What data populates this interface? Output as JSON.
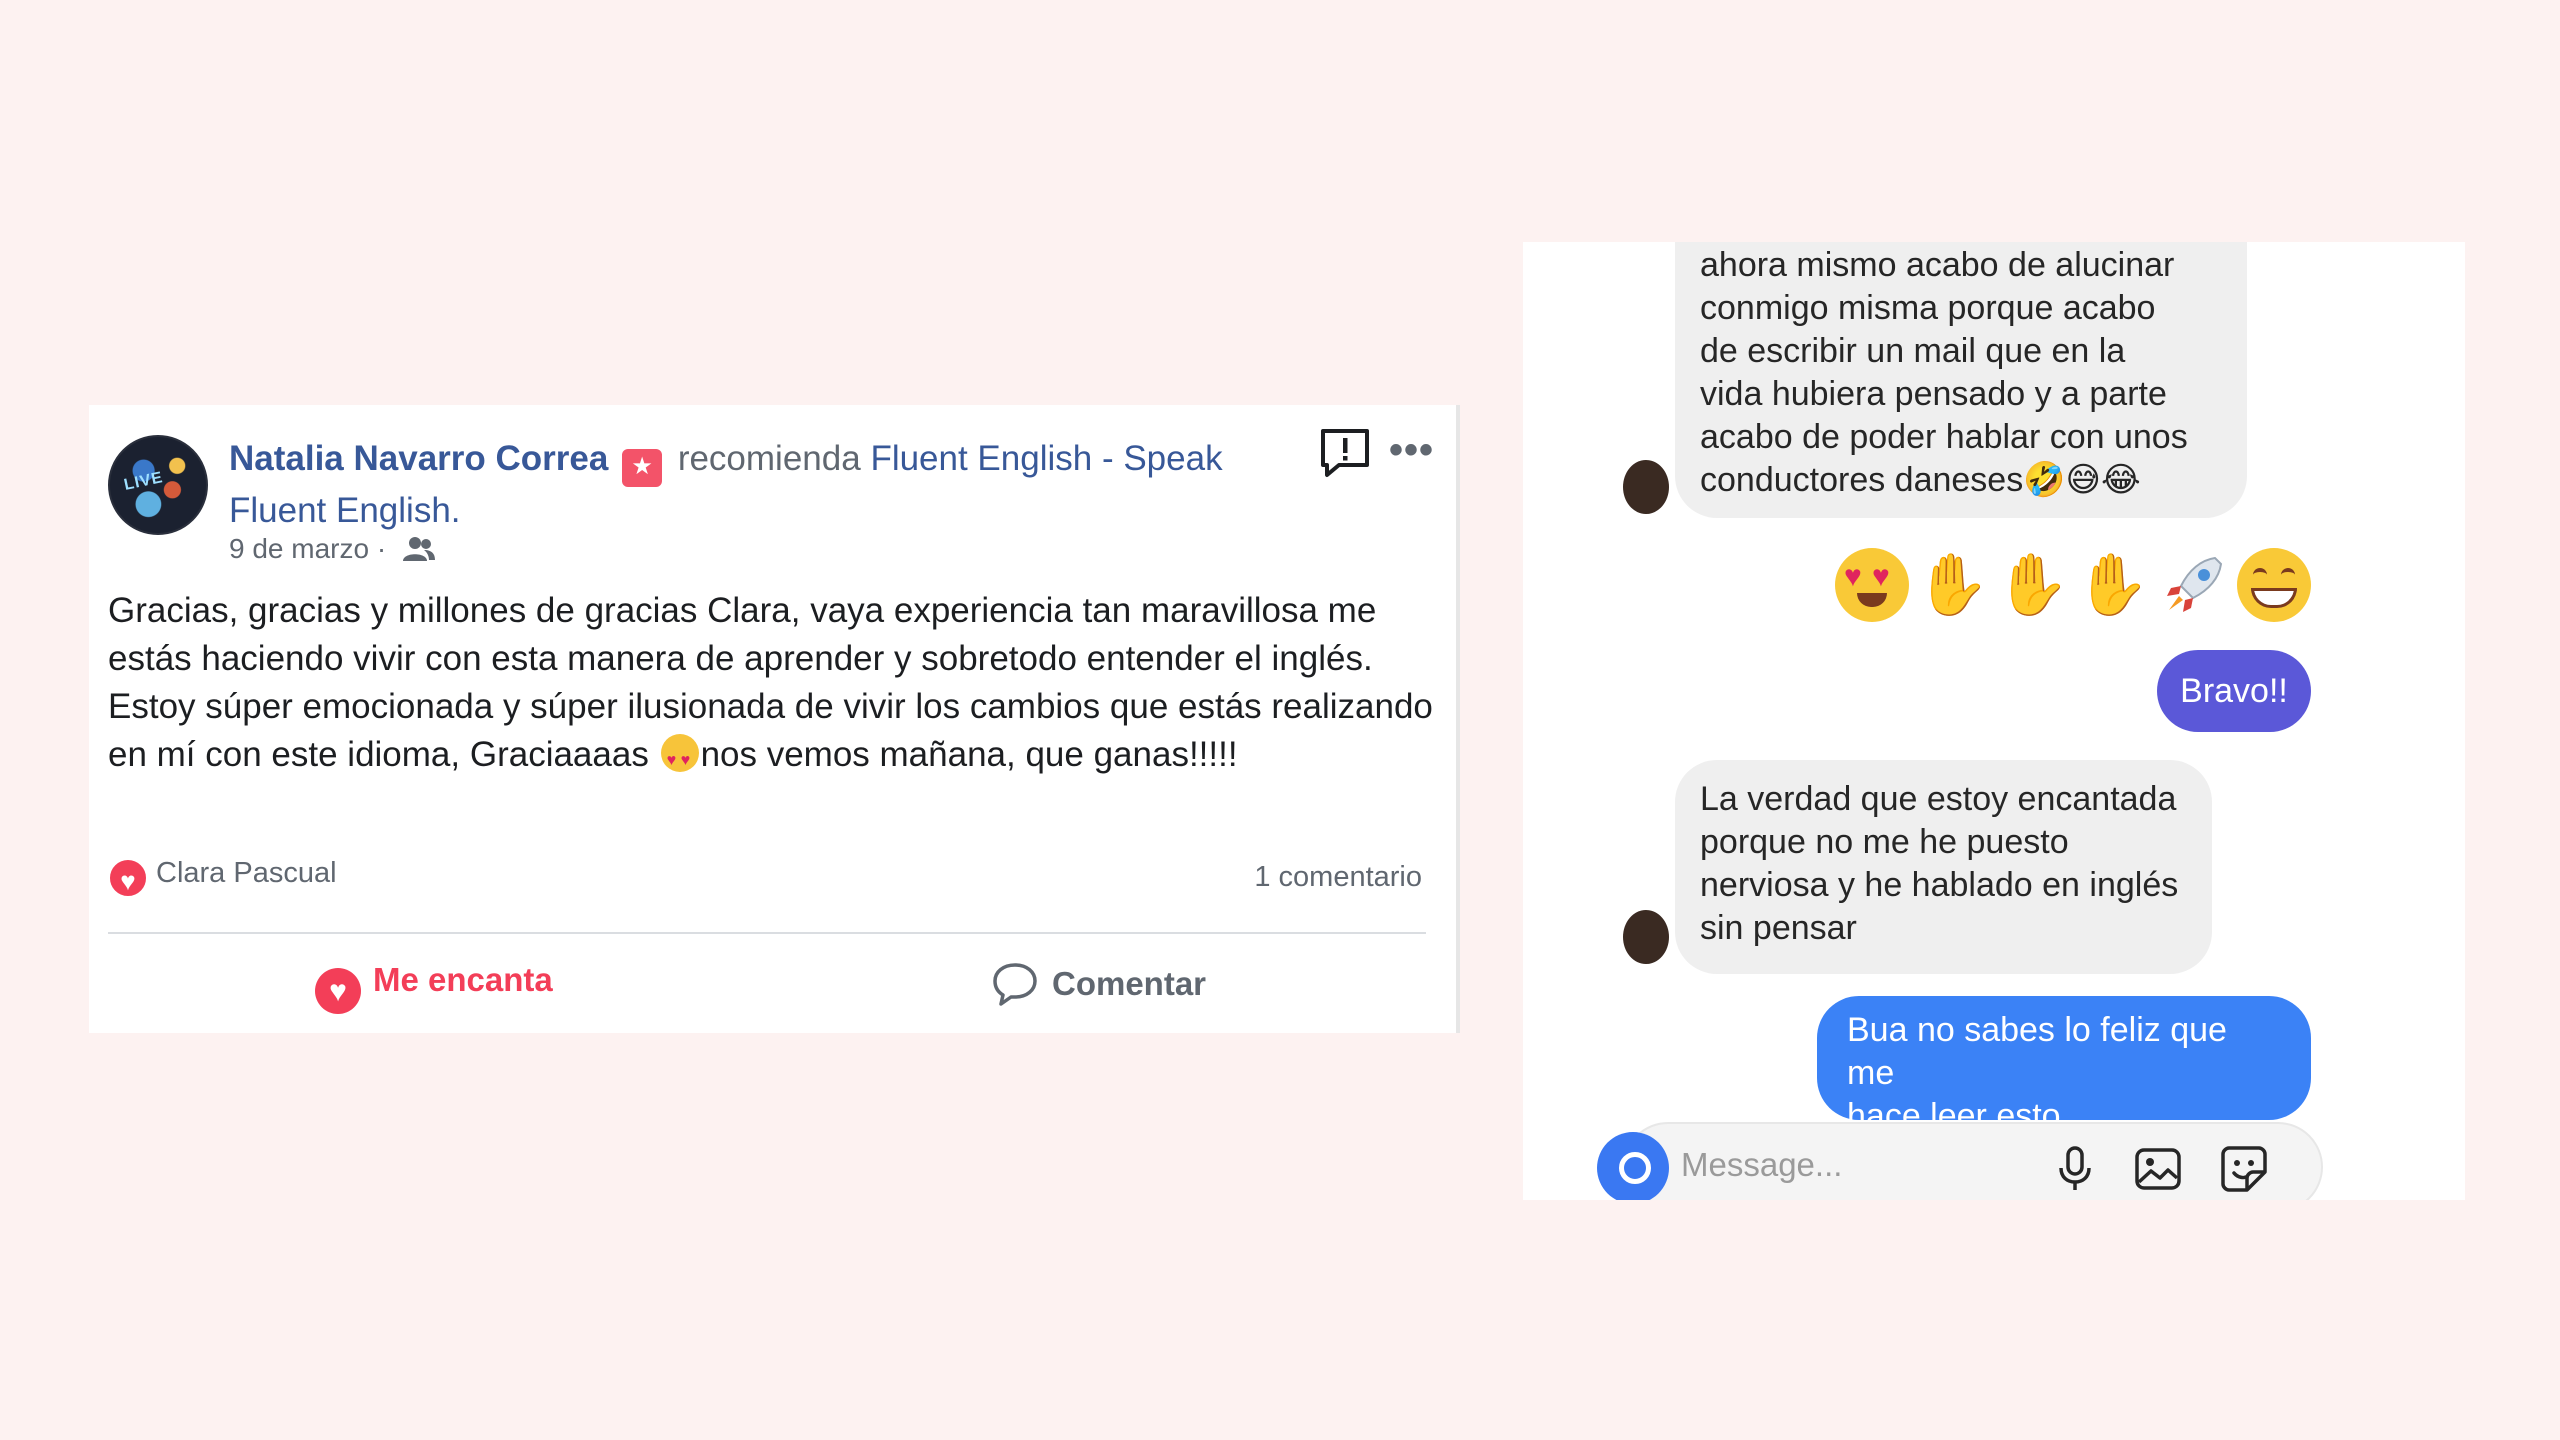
{
  "facebook_post": {
    "author": "Natalia Navarro Correa",
    "verb": "recomienda",
    "page_name": "Fluent English - Speak Fluent English.",
    "date": "9 de marzo",
    "separator": " · ",
    "avatar_text": "LIVE",
    "body_part1": "Gracias, gracias y millones de gracias Clara, vaya experiencia tan maravillosa me estás haciendo vivir con esta manera de aprender y sobretodo entender el inglés. Estoy súper emocionada y súper ilusionada de vivir los cambios que estás realizando en mí con este idioma, Graciaaaas ",
    "body_part2": "nos vemos mañana, que ganas!!!!!",
    "reaction_by": "Clara Pascual",
    "comments_count": "1 comentario",
    "love_label": "Me encanta",
    "comment_label": "Comentar",
    "icons": [
      "recommend-badge-icon",
      "report-icon",
      "more-dots-icon",
      "friends-icon",
      "heart-reaction-icon",
      "comment-icon"
    ],
    "colors": {
      "link": "#385898",
      "love": "#f33e58",
      "muted": "#606770"
    }
  },
  "chat": {
    "messages": [
      {
        "from": "contact",
        "text_lines": [
          "ahora mismo acabo de alucinar",
          "conmigo misma porque acabo",
          "de escribir un mail que en la",
          "vida hubiera pensado y a parte",
          "acabo de poder hablar con unos",
          "conductores daneses🤣😅😂"
        ]
      },
      {
        "from": "me",
        "type": "emoji",
        "emojis": [
          "😍",
          "👏",
          "👏",
          "👏",
          "🚀",
          "😁"
        ]
      },
      {
        "from": "me",
        "text": "Bravo!!"
      },
      {
        "from": "contact",
        "text_lines": [
          "La verdad que estoy encantada",
          "porque no me he puesto",
          "nerviosa y he hablado en inglés",
          "sin pensar"
        ]
      },
      {
        "from": "me",
        "text_lines": [
          "Bua no sabes lo feliz que me",
          "hace leer esto"
        ]
      }
    ],
    "input_placeholder": "Message...",
    "icons": [
      "camera-icon",
      "microphone-icon",
      "gallery-icon",
      "sticker-icon"
    ],
    "colors": {
      "purple_bubble": "#5b58d8",
      "blue_bubble": "#3b82f6",
      "incoming_bubble": "#efefef"
    }
  }
}
